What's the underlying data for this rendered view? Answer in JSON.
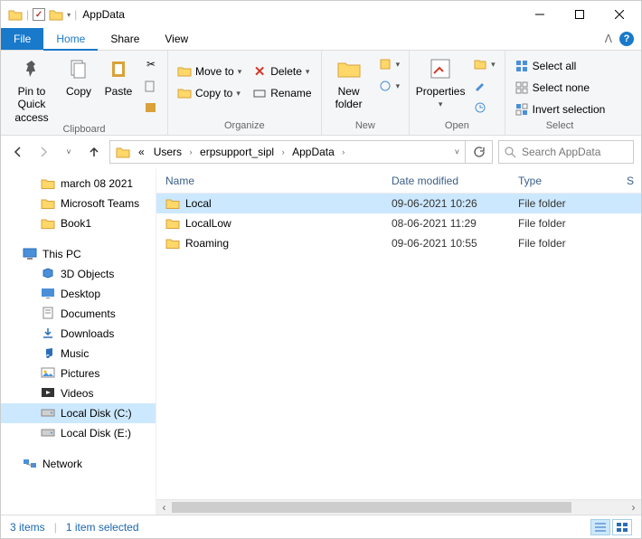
{
  "window": {
    "title": "AppData"
  },
  "tabs": {
    "file": "File",
    "home": "Home",
    "share": "Share",
    "view": "View"
  },
  "ribbon": {
    "clipboard": {
      "label": "Clipboard",
      "pin": "Pin to Quick\naccess",
      "copy": "Copy",
      "paste": "Paste"
    },
    "organize": {
      "label": "Organize",
      "moveto": "Move to",
      "copyto": "Copy to",
      "delete": "Delete",
      "rename": "Rename"
    },
    "new": {
      "label": "New",
      "newfolder": "New\nfolder"
    },
    "open": {
      "label": "Open",
      "properties": "Properties"
    },
    "select": {
      "label": "Select",
      "all": "Select all",
      "none": "Select none",
      "invert": "Invert selection"
    }
  },
  "breadcrumb": {
    "prefix": "«",
    "items": [
      "Users",
      "erpsupport_sipl",
      "AppData"
    ]
  },
  "search": {
    "placeholder": "Search AppData"
  },
  "columns": {
    "name": "Name",
    "date": "Date modified",
    "type": "Type",
    "last": "S"
  },
  "rows": [
    {
      "name": "Local",
      "date": "09-06-2021 10:26",
      "type": "File folder",
      "selected": true
    },
    {
      "name": "LocalLow",
      "date": "08-06-2021 11:29",
      "type": "File folder",
      "selected": false
    },
    {
      "name": "Roaming",
      "date": "09-06-2021 10:55",
      "type": "File folder",
      "selected": false
    }
  ],
  "sidebar": {
    "quick": [
      "march 08 2021",
      "Microsoft Teams",
      "Book1"
    ],
    "thispc_label": "This PC",
    "thispc": [
      "3D Objects",
      "Desktop",
      "Documents",
      "Downloads",
      "Music",
      "Pictures",
      "Videos",
      "Local Disk (C:)",
      "Local Disk (E:)"
    ],
    "network": "Network",
    "selected": "Local Disk (C:)"
  },
  "status": {
    "count": "3 items",
    "selected": "1 item selected"
  }
}
